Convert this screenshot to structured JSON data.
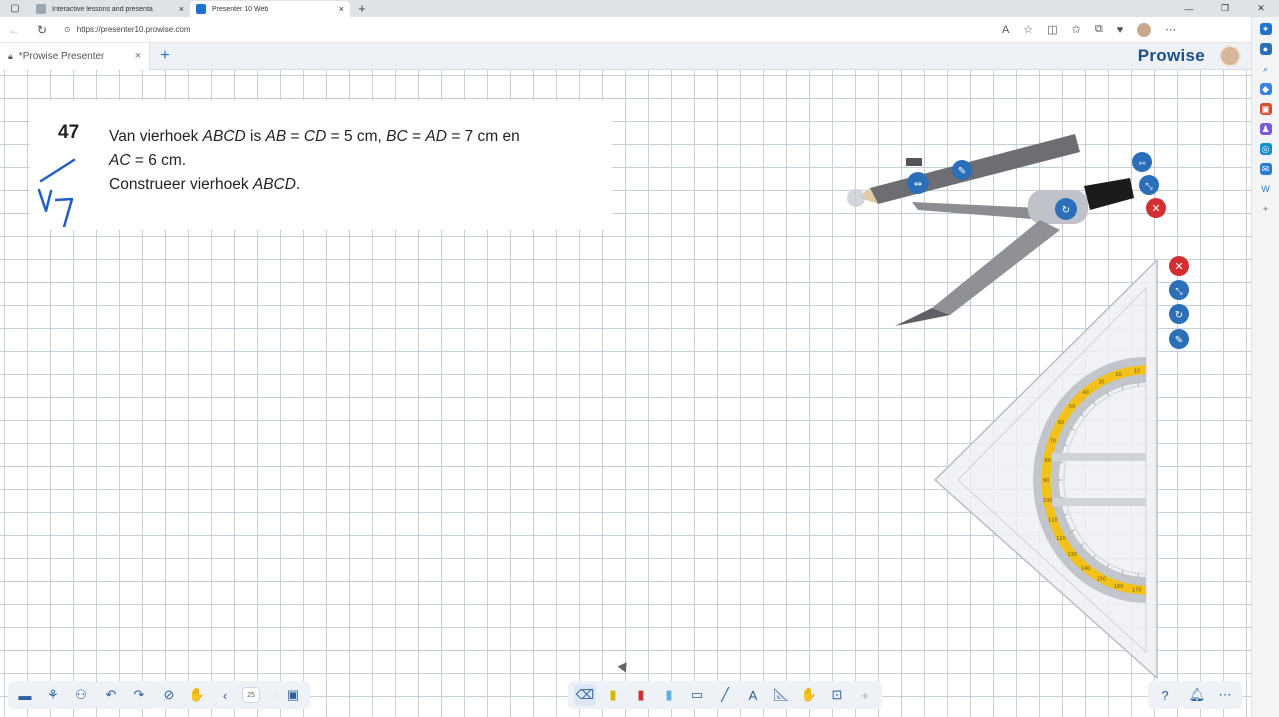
{
  "browser": {
    "tabs": [
      {
        "title": "Interactive lessons and presenta",
        "active": false
      },
      {
        "title": "Presenter 10 Web",
        "active": true
      }
    ],
    "address": "https://presenter10.prowise.com"
  },
  "app": {
    "tab_title": "*Prowise Presenter",
    "brand": "Prowise"
  },
  "exercise": {
    "number": "47",
    "line1_prefix": "Van vierhoek ",
    "line1_quad": "ABCD",
    "line1_is": " is ",
    "line1_ab": "AB",
    "line1_eq1": " = ",
    "line1_cd": "CD",
    "line1_val1": " = 5 cm, ",
    "line1_bc": "BC",
    "line1_eq2": " = ",
    "line1_ad": "AD",
    "line1_val2": " = 7 cm en",
    "line2_ac": "AC",
    "line2_val": " = 6 cm.",
    "line3_prefix": "Construeer vierhoek ",
    "line3_quad": "ABCD",
    "line3_end": "."
  },
  "toolbar": {
    "page_number": "25"
  },
  "protractor_scale": [
    "10",
    "20",
    "30",
    "40",
    "50",
    "60",
    "70",
    "80",
    "90",
    "100",
    "110",
    "120",
    "130",
    "140",
    "150",
    "160",
    "170"
  ],
  "colors": {
    "accent": "#2a6fb8",
    "close_red": "#d32f2f",
    "grid": "#c4cfdb",
    "protractor_yellow": "#f2c21b"
  }
}
